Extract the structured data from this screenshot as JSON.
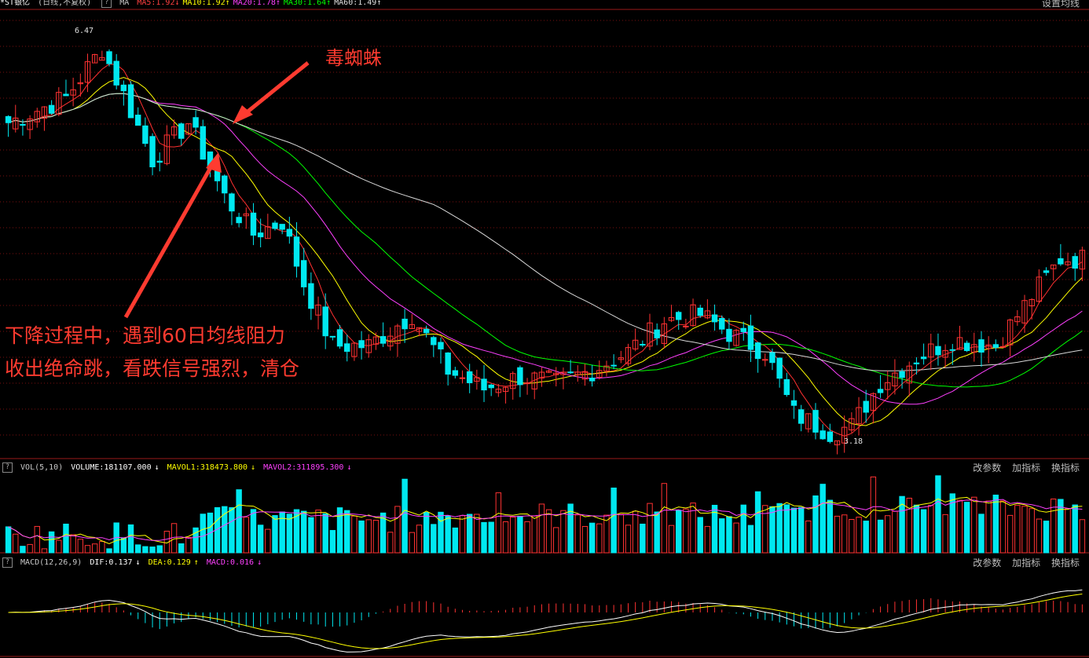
{
  "header": {
    "title": "*ST银亿",
    "mode": "(日线,不复权)",
    "ma_label": "MA",
    "ma": [
      {
        "text": "MA5:1.92",
        "color": "#ff4040",
        "arrow": "↓"
      },
      {
        "text": "MA10:1.92",
        "color": "#ffff00",
        "arrow": "↑"
      },
      {
        "text": "MA20:1.78",
        "color": "#ff40ff",
        "arrow": "↑"
      },
      {
        "text": "MA30:1.64",
        "color": "#00ff00",
        "arrow": "↑"
      },
      {
        "text": "MA60:1.49",
        "color": "#e0e0e0",
        "arrow": "↑"
      }
    ],
    "right_button": "设置均线"
  },
  "price_labels": {
    "high": "6.47",
    "low": "3.18"
  },
  "annotations": {
    "spider": "毒蜘蛛",
    "line1": "下降过程中，遇到60日均线阻力",
    "line2": "收出绝命跳，看跌信号强烈，清仓"
  },
  "vol_panel": {
    "name": "VOL(5,10)",
    "volume": "VOLUME:181107.000",
    "volume_arrow": "↓",
    "mavol1": "MAVOL1:318473.800",
    "mavol1_arrow": "↓",
    "mavol2": "MAVOL2:311895.300",
    "mavol2_arrow": "↓",
    "buttons": [
      "改参数",
      "加指标",
      "换指标"
    ]
  },
  "macd_panel": {
    "name": "MACD(12,26,9)",
    "dif": "DIF:0.137",
    "dif_arrow": "↓",
    "dea": "DEA:0.129",
    "dea_arrow": "↑",
    "macd": "MACD:0.016",
    "macd_arrow": "↓",
    "buttons": [
      "改参数",
      "加指标",
      "换指标"
    ]
  },
  "colors": {
    "up": "#ff3232",
    "down": "#00e8f0",
    "ma5": "#ff3030",
    "ma10": "#ffff00",
    "ma20": "#ff40ff",
    "ma30": "#00ff00",
    "ma60": "#d8d8d8",
    "grid": "#7a1010",
    "annotation": "#ff3b30"
  },
  "chart_data": {
    "type": "candlestick",
    "y_range": [
      3.0,
      6.6
    ],
    "count": 150,
    "anchors": [
      [
        0,
        5.7
      ],
      [
        8,
        5.9
      ],
      [
        13,
        6.3
      ],
      [
        17,
        5.8
      ],
      [
        20,
        5.4
      ],
      [
        25,
        5.7
      ],
      [
        30,
        5.1
      ],
      [
        34,
        4.8
      ],
      [
        38,
        4.9
      ],
      [
        41,
        4.4
      ],
      [
        45,
        3.9
      ],
      [
        50,
        3.9
      ],
      [
        56,
        4.15
      ],
      [
        61,
        3.7
      ],
      [
        66,
        3.55
      ],
      [
        71,
        3.65
      ],
      [
        76,
        3.6
      ],
      [
        81,
        3.7
      ],
      [
        86,
        3.85
      ],
      [
        91,
        4.1
      ],
      [
        96,
        4.15
      ],
      [
        100,
        4.0
      ],
      [
        105,
        3.85
      ],
      [
        109,
        3.35
      ],
      [
        114,
        3.2
      ],
      [
        117,
        3.25
      ],
      [
        121,
        3.6
      ],
      [
        126,
        3.8
      ],
      [
        131,
        3.95
      ],
      [
        137,
        3.9
      ],
      [
        142,
        4.3
      ],
      [
        146,
        4.6
      ],
      [
        149,
        4.6
      ]
    ]
  }
}
